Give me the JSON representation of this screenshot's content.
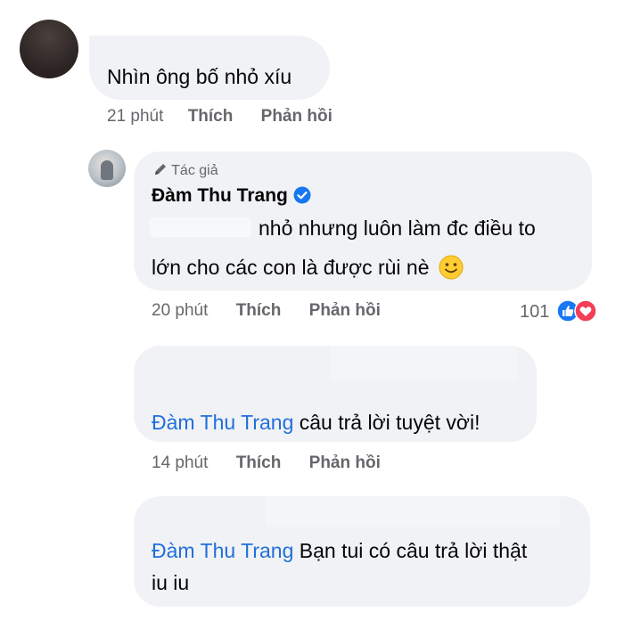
{
  "comments": [
    {
      "text": "Nhìn ông bố nhỏ xíu",
      "time": "21 phút",
      "like_label": "Thích",
      "reply_label": "Phản hồi"
    },
    {
      "role_label": "Tác giả",
      "author": "Đàm Thu Trang",
      "line1": "nhỏ nhưng luôn làm đc điều to",
      "line2": "lớn cho các con là được rùi nè",
      "time": "20 phút",
      "like_label": "Thích",
      "reply_label": "Phản hồi",
      "reaction_count": "101",
      "reaction_icons": [
        "like-icon",
        "love-icon"
      ]
    },
    {
      "mention": "Đàm Thu Trang",
      "text": "câu trả lời tuyệt vời!",
      "time": "14 phút",
      "like_label": "Thích",
      "reply_label": "Phản hồi"
    },
    {
      "mention": "Đàm Thu Trang",
      "text_line1": "Bạn tui có câu trả lời thật",
      "text_line2": "iu iu"
    }
  ],
  "colors": {
    "bubble": "#f0f2f5",
    "meta_text": "#65676b",
    "mention": "#216fdb",
    "verified": "#1877f2",
    "love": "#f33e58"
  }
}
